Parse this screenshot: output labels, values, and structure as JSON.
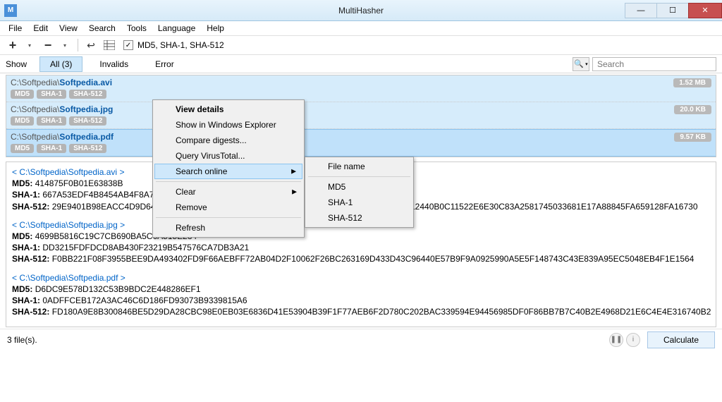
{
  "window": {
    "title": "MultiHasher",
    "icon_label": "M"
  },
  "menu": {
    "file": "File",
    "edit": "Edit",
    "view": "View",
    "search": "Search",
    "tools": "Tools",
    "language": "Language",
    "help": "Help"
  },
  "toolbar": {
    "hash_modes": "MD5, SHA-1, SHA-512"
  },
  "filters": {
    "show": "Show",
    "all": "All (3)",
    "invalids": "Invalids",
    "error": "Error"
  },
  "search": {
    "placeholder": "Search"
  },
  "files": [
    {
      "dir": "C:\\Softpedia\\",
      "name": "Softpedia.avi",
      "size": "1.52 MB",
      "badges": [
        "MD5",
        "SHA-1",
        "SHA-512"
      ]
    },
    {
      "dir": "C:\\Softpedia\\",
      "name": "Softpedia.jpg",
      "size": "20.0 KB",
      "badges": [
        "MD5",
        "SHA-1",
        "SHA-512"
      ]
    },
    {
      "dir": "C:\\Softpedia\\",
      "name": "Softpedia.pdf",
      "size": "9.57 KB",
      "badges": [
        "MD5",
        "SHA-1",
        "SHA-512"
      ]
    }
  ],
  "context": {
    "view_details": "View details",
    "show_explorer": "Show in Windows Explorer",
    "compare": "Compare digests...",
    "virustotal": "Query VirusTotal...",
    "search_online": "Search online",
    "clear": "Clear",
    "remove": "Remove",
    "refresh": "Refresh",
    "sub": {
      "file_name": "File name",
      "md5": "MD5",
      "sha1": "SHA-1",
      "sha512": "SHA-512"
    }
  },
  "details": [
    {
      "path": "C:\\Softpedia\\Softpedia.avi",
      "md5": "414875F0B01E63838B",
      "sha1": "667A53EDF4B8454AB4F8A7872E3C71E405EF98C6",
      "sha512": "29E9401B98EACC4D9D648BED95666D587CC0FF8D9DBE8E54EF5D7B8316A498FA3CEBC12440B0C11522E6E30C83A2581745033681E17A88845FA659128FA16730"
    },
    {
      "path": "C:\\Softpedia\\Softpedia.jpg",
      "md5": "4699B5816C19C7CB690BA5C6A515E234",
      "sha1": "DD3215FDFDCD8AB430F23219B547576CA7DB3A21",
      "sha512": "F0BB221F08F3955BEE9DA493402FD9F66AEBFF72AB04D2F10062F26BC263169D433D43C96440E57B9F9A0925990A5E5F148743C43E839A95EC5048EB4F1E1564"
    },
    {
      "path": "C:\\Softpedia\\Softpedia.pdf",
      "md5": "D6DC9E578D132C53B9BDC2E448286EF1",
      "sha1": "0ADFFCEB172A3AC46C6D186FD93073B9339815A6",
      "sha512": "FD180A9E8B300846BE5D29DA28CBC98E0EB03E6836D41E53904B39F1F77AEB6F2D780C202BAC339594E94456985DF0F86BB7B7C40B2E4968D21E6C4E4E316740B2"
    }
  ],
  "status": {
    "count": "3 file(s).",
    "calculate": "Calculate"
  }
}
